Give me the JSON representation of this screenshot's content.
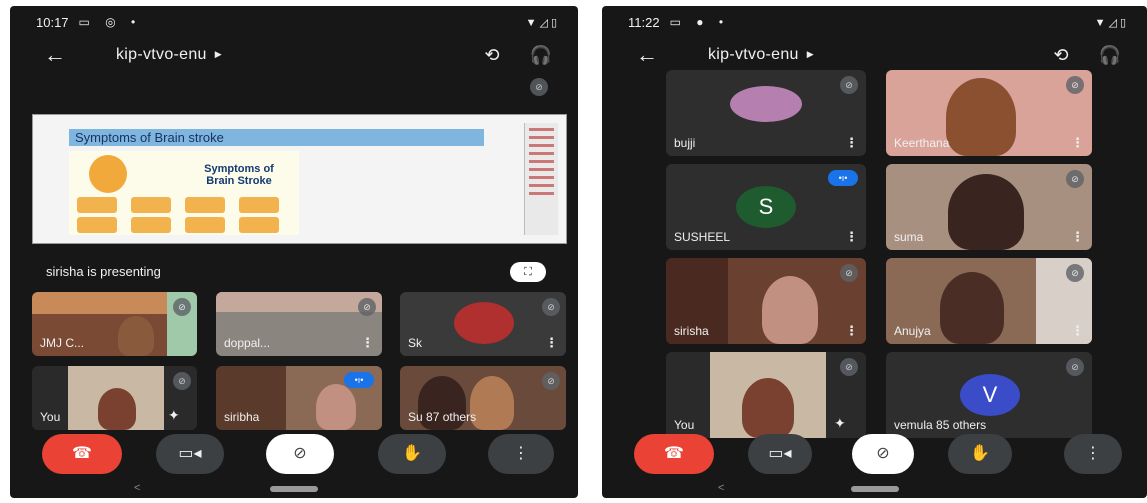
{
  "left": {
    "status": {
      "time": "10:17",
      "icons": "▭ ◎ •",
      "right_icons": "▼◿▯"
    },
    "topbar": {
      "back": "←",
      "meeting_code": "kip-vtvo-enu",
      "caret": "▶",
      "camera_switch": "⟲",
      "audio": "🎧"
    },
    "slide": {
      "title": "Symptoms of Brain stroke",
      "poster_heading": "Symptoms of Brain Stroke"
    },
    "presenting_label": "sirisha is presenting",
    "fullscreen": "⛶",
    "tiles": [
      {
        "name": "JMJ C..."
      },
      {
        "name": "doppal..."
      },
      {
        "name": "Sk"
      },
      {
        "name": "You"
      },
      {
        "name": "siribha"
      },
      {
        "name": "Su",
        "others": "87 others"
      }
    ],
    "menu": "⋮",
    "mic_off": "⊘",
    "speaking": "•ı•",
    "effects": "✦",
    "callbar": {
      "end": "☎",
      "video": "▭◂",
      "mute": "⊘",
      "hand": "✋",
      "more": "⋮"
    },
    "nav_back": "<"
  },
  "right": {
    "status": {
      "time": "11:22",
      "icons": "▭ ● •",
      "right_icons": "▼◿▯"
    },
    "topbar": {
      "back": "←",
      "meeting_code": "kip-vtvo-enu",
      "caret": "▶",
      "camera_switch": "⟲",
      "audio": "🎧"
    },
    "tiles": [
      {
        "name": "bujji"
      },
      {
        "name": "Keerthana"
      },
      {
        "name": "SUSHEEL",
        "letter": "S"
      },
      {
        "name": "suma"
      },
      {
        "name": "sirisha"
      },
      {
        "name": "Anujya"
      },
      {
        "name": "You"
      },
      {
        "name": "vemula",
        "letter": "V",
        "others": "85 others"
      }
    ],
    "menu": "⋮",
    "mic_off": "⊘",
    "speaking": "•ı•",
    "effects": "✦",
    "callbar": {
      "end": "☎",
      "video": "▭◂",
      "mute": "⊘",
      "hand": "✋",
      "more": "⋮"
    },
    "nav_back": "<"
  },
  "colors": {
    "background": "#171717",
    "tile": "#2e2e2e",
    "end_call": "#ea4335",
    "speaking_badge": "#1a73e8",
    "avatar_green": "#1e5b2e",
    "avatar_blue": "#3b4cc8",
    "slide_title_band": "#7fb6df"
  }
}
